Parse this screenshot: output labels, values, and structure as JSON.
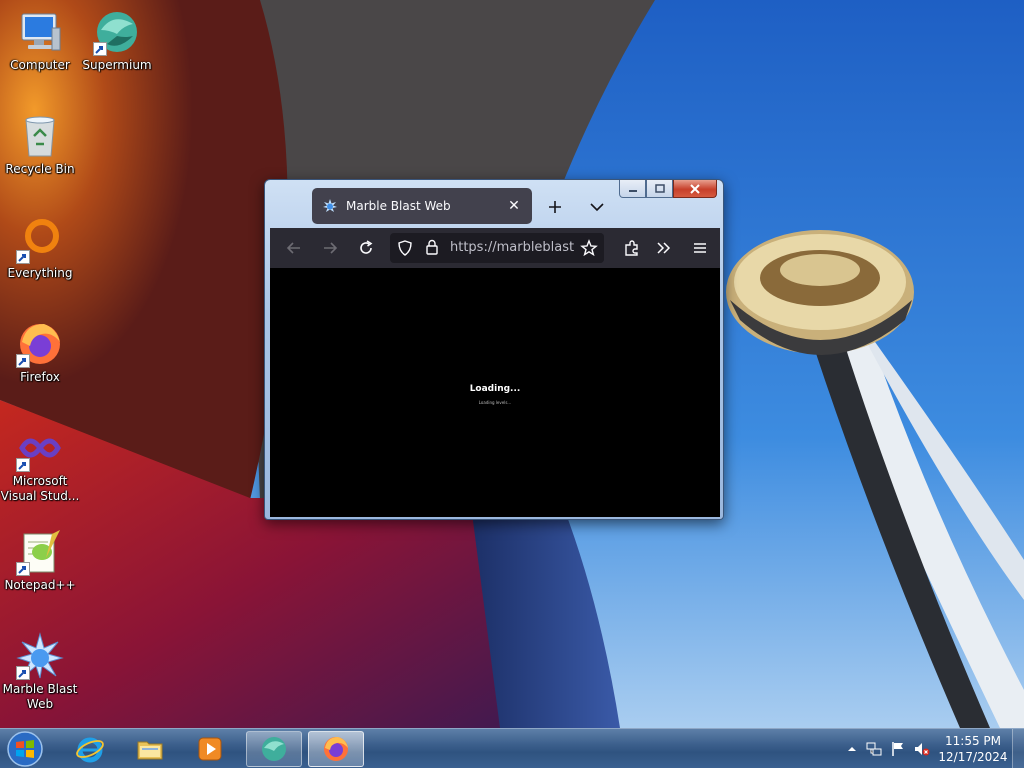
{
  "desktop": {
    "icons": [
      {
        "label": "Computer",
        "icon": "computer-icon"
      },
      {
        "label": "Supermium",
        "icon": "supermium-icon"
      },
      {
        "label": "Recycle Bin",
        "icon": "recycle-bin-icon"
      },
      {
        "label": "Everything",
        "icon": "everything-icon"
      },
      {
        "label": "Firefox",
        "icon": "firefox-icon"
      },
      {
        "label": "Microsoft Visual Stud...",
        "icon": "visual-studio-icon"
      },
      {
        "label": "Notepad++",
        "icon": "notepadpp-icon"
      },
      {
        "label": "Marble Blast Web",
        "icon": "marble-blast-icon"
      }
    ]
  },
  "browser": {
    "tab_title": "Marble Blast Web",
    "tab_close": "✕",
    "url": "https://marbleblast.vani.ga",
    "loading_text": "Loading...",
    "loading_sub": "Loading levels..."
  },
  "taskbar": {
    "pinned": [
      {
        "name": "internet-explorer-icon"
      },
      {
        "name": "file-explorer-icon"
      },
      {
        "name": "media-player-icon"
      },
      {
        "name": "supermium-icon"
      },
      {
        "name": "firefox-icon"
      }
    ],
    "clock_time": "11:55 PM",
    "clock_date": "12/17/2024"
  },
  "colors": {
    "tab_bg": "#42414d",
    "navbar_bg": "#2b2a33",
    "urlbar_bg": "#1c1b22",
    "taskbar": "#3c5f8c"
  }
}
